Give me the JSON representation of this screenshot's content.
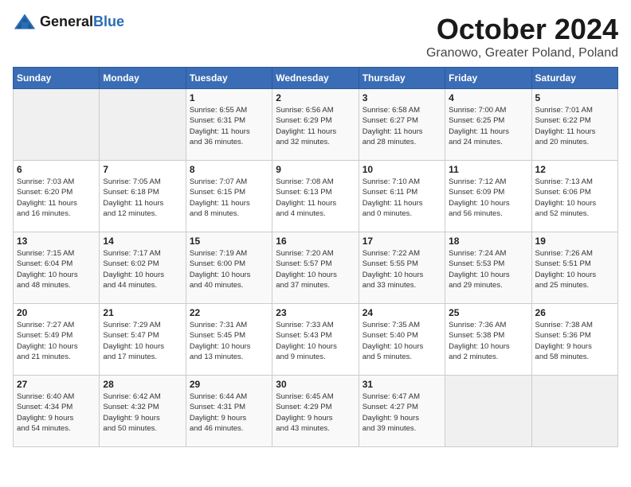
{
  "header": {
    "logo_general": "General",
    "logo_blue": "Blue",
    "month": "October 2024",
    "location": "Granowo, Greater Poland, Poland"
  },
  "days_of_week": [
    "Sunday",
    "Monday",
    "Tuesday",
    "Wednesday",
    "Thursday",
    "Friday",
    "Saturday"
  ],
  "weeks": [
    [
      {
        "day": "",
        "info": ""
      },
      {
        "day": "",
        "info": ""
      },
      {
        "day": "1",
        "info": "Sunrise: 6:55 AM\nSunset: 6:31 PM\nDaylight: 11 hours\nand 36 minutes."
      },
      {
        "day": "2",
        "info": "Sunrise: 6:56 AM\nSunset: 6:29 PM\nDaylight: 11 hours\nand 32 minutes."
      },
      {
        "day": "3",
        "info": "Sunrise: 6:58 AM\nSunset: 6:27 PM\nDaylight: 11 hours\nand 28 minutes."
      },
      {
        "day": "4",
        "info": "Sunrise: 7:00 AM\nSunset: 6:25 PM\nDaylight: 11 hours\nand 24 minutes."
      },
      {
        "day": "5",
        "info": "Sunrise: 7:01 AM\nSunset: 6:22 PM\nDaylight: 11 hours\nand 20 minutes."
      }
    ],
    [
      {
        "day": "6",
        "info": "Sunrise: 7:03 AM\nSunset: 6:20 PM\nDaylight: 11 hours\nand 16 minutes."
      },
      {
        "day": "7",
        "info": "Sunrise: 7:05 AM\nSunset: 6:18 PM\nDaylight: 11 hours\nand 12 minutes."
      },
      {
        "day": "8",
        "info": "Sunrise: 7:07 AM\nSunset: 6:15 PM\nDaylight: 11 hours\nand 8 minutes."
      },
      {
        "day": "9",
        "info": "Sunrise: 7:08 AM\nSunset: 6:13 PM\nDaylight: 11 hours\nand 4 minutes."
      },
      {
        "day": "10",
        "info": "Sunrise: 7:10 AM\nSunset: 6:11 PM\nDaylight: 11 hours\nand 0 minutes."
      },
      {
        "day": "11",
        "info": "Sunrise: 7:12 AM\nSunset: 6:09 PM\nDaylight: 10 hours\nand 56 minutes."
      },
      {
        "day": "12",
        "info": "Sunrise: 7:13 AM\nSunset: 6:06 PM\nDaylight: 10 hours\nand 52 minutes."
      }
    ],
    [
      {
        "day": "13",
        "info": "Sunrise: 7:15 AM\nSunset: 6:04 PM\nDaylight: 10 hours\nand 48 minutes."
      },
      {
        "day": "14",
        "info": "Sunrise: 7:17 AM\nSunset: 6:02 PM\nDaylight: 10 hours\nand 44 minutes."
      },
      {
        "day": "15",
        "info": "Sunrise: 7:19 AM\nSunset: 6:00 PM\nDaylight: 10 hours\nand 40 minutes."
      },
      {
        "day": "16",
        "info": "Sunrise: 7:20 AM\nSunset: 5:57 PM\nDaylight: 10 hours\nand 37 minutes."
      },
      {
        "day": "17",
        "info": "Sunrise: 7:22 AM\nSunset: 5:55 PM\nDaylight: 10 hours\nand 33 minutes."
      },
      {
        "day": "18",
        "info": "Sunrise: 7:24 AM\nSunset: 5:53 PM\nDaylight: 10 hours\nand 29 minutes."
      },
      {
        "day": "19",
        "info": "Sunrise: 7:26 AM\nSunset: 5:51 PM\nDaylight: 10 hours\nand 25 minutes."
      }
    ],
    [
      {
        "day": "20",
        "info": "Sunrise: 7:27 AM\nSunset: 5:49 PM\nDaylight: 10 hours\nand 21 minutes."
      },
      {
        "day": "21",
        "info": "Sunrise: 7:29 AM\nSunset: 5:47 PM\nDaylight: 10 hours\nand 17 minutes."
      },
      {
        "day": "22",
        "info": "Sunrise: 7:31 AM\nSunset: 5:45 PM\nDaylight: 10 hours\nand 13 minutes."
      },
      {
        "day": "23",
        "info": "Sunrise: 7:33 AM\nSunset: 5:43 PM\nDaylight: 10 hours\nand 9 minutes."
      },
      {
        "day": "24",
        "info": "Sunrise: 7:35 AM\nSunset: 5:40 PM\nDaylight: 10 hours\nand 5 minutes."
      },
      {
        "day": "25",
        "info": "Sunrise: 7:36 AM\nSunset: 5:38 PM\nDaylight: 10 hours\nand 2 minutes."
      },
      {
        "day": "26",
        "info": "Sunrise: 7:38 AM\nSunset: 5:36 PM\nDaylight: 9 hours\nand 58 minutes."
      }
    ],
    [
      {
        "day": "27",
        "info": "Sunrise: 6:40 AM\nSunset: 4:34 PM\nDaylight: 9 hours\nand 54 minutes."
      },
      {
        "day": "28",
        "info": "Sunrise: 6:42 AM\nSunset: 4:32 PM\nDaylight: 9 hours\nand 50 minutes."
      },
      {
        "day": "29",
        "info": "Sunrise: 6:44 AM\nSunset: 4:31 PM\nDaylight: 9 hours\nand 46 minutes."
      },
      {
        "day": "30",
        "info": "Sunrise: 6:45 AM\nSunset: 4:29 PM\nDaylight: 9 hours\nand 43 minutes."
      },
      {
        "day": "31",
        "info": "Sunrise: 6:47 AM\nSunset: 4:27 PM\nDaylight: 9 hours\nand 39 minutes."
      },
      {
        "day": "",
        "info": ""
      },
      {
        "day": "",
        "info": ""
      }
    ]
  ]
}
